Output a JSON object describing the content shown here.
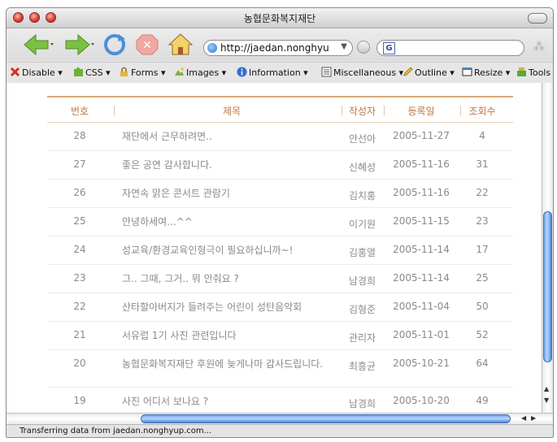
{
  "window": {
    "title": "농협문화복지재단"
  },
  "navbar": {
    "url": "http://jaedan.nonghyu"
  },
  "webdev_toolbar": {
    "items": [
      "Disable",
      "CSS",
      "Forms",
      "Images",
      "Information",
      "Miscellaneous",
      "Outline",
      "Resize",
      "Tools"
    ]
  },
  "table": {
    "headers": {
      "num": "번호",
      "subject": "제목",
      "author": "작성자",
      "date": "등록일",
      "hits": "조회수"
    },
    "rows": [
      {
        "num": "28",
        "subject": "재단에서 근무하려면..",
        "author": "안선아",
        "date": "2005-11-27",
        "hits": "4"
      },
      {
        "num": "27",
        "subject": "좋은 공연 감사합니다.",
        "author": "신혜성",
        "date": "2005-11-16",
        "hits": "31"
      },
      {
        "num": "26",
        "subject": "자연속 맑은 콘서트 관람기",
        "author": "김치홍",
        "date": "2005-11-16",
        "hits": "22"
      },
      {
        "num": "25",
        "subject": "안녕하세여...^^",
        "author": "이기원",
        "date": "2005-11-15",
        "hits": "23"
      },
      {
        "num": "24",
        "subject": "성교육/환경교육인형극이 필요하십니까~!",
        "author": "김홍열",
        "date": "2005-11-14",
        "hits": "17"
      },
      {
        "num": "23",
        "subject": "그.. 그때, 그거.. 뭐 안줘요 ?",
        "author": "남경희",
        "date": "2005-11-14",
        "hits": "25"
      },
      {
        "num": "22",
        "subject": "산타할아버지가 들려주는 어린이 성탄음악회",
        "author": "김형준",
        "date": "2005-11-04",
        "hits": "50"
      },
      {
        "num": "21",
        "subject": "서유럽 1기 사진 관련입니다",
        "author": "관리자",
        "date": "2005-11-01",
        "hits": "52"
      },
      {
        "num": "20",
        "subject": "농협문화복지재단 후원에 늦게나마 감사드립니다.",
        "author": "최흥균",
        "date": "2005-10-21",
        "hits": "64"
      },
      {
        "num": "19",
        "subject": "사진 어디서 보나요 ?",
        "author": "남경희",
        "date": "2005-10-20",
        "hits": "49"
      }
    ]
  },
  "status": {
    "text": "Transferring data from jaedan.nonghyup.com..."
  }
}
